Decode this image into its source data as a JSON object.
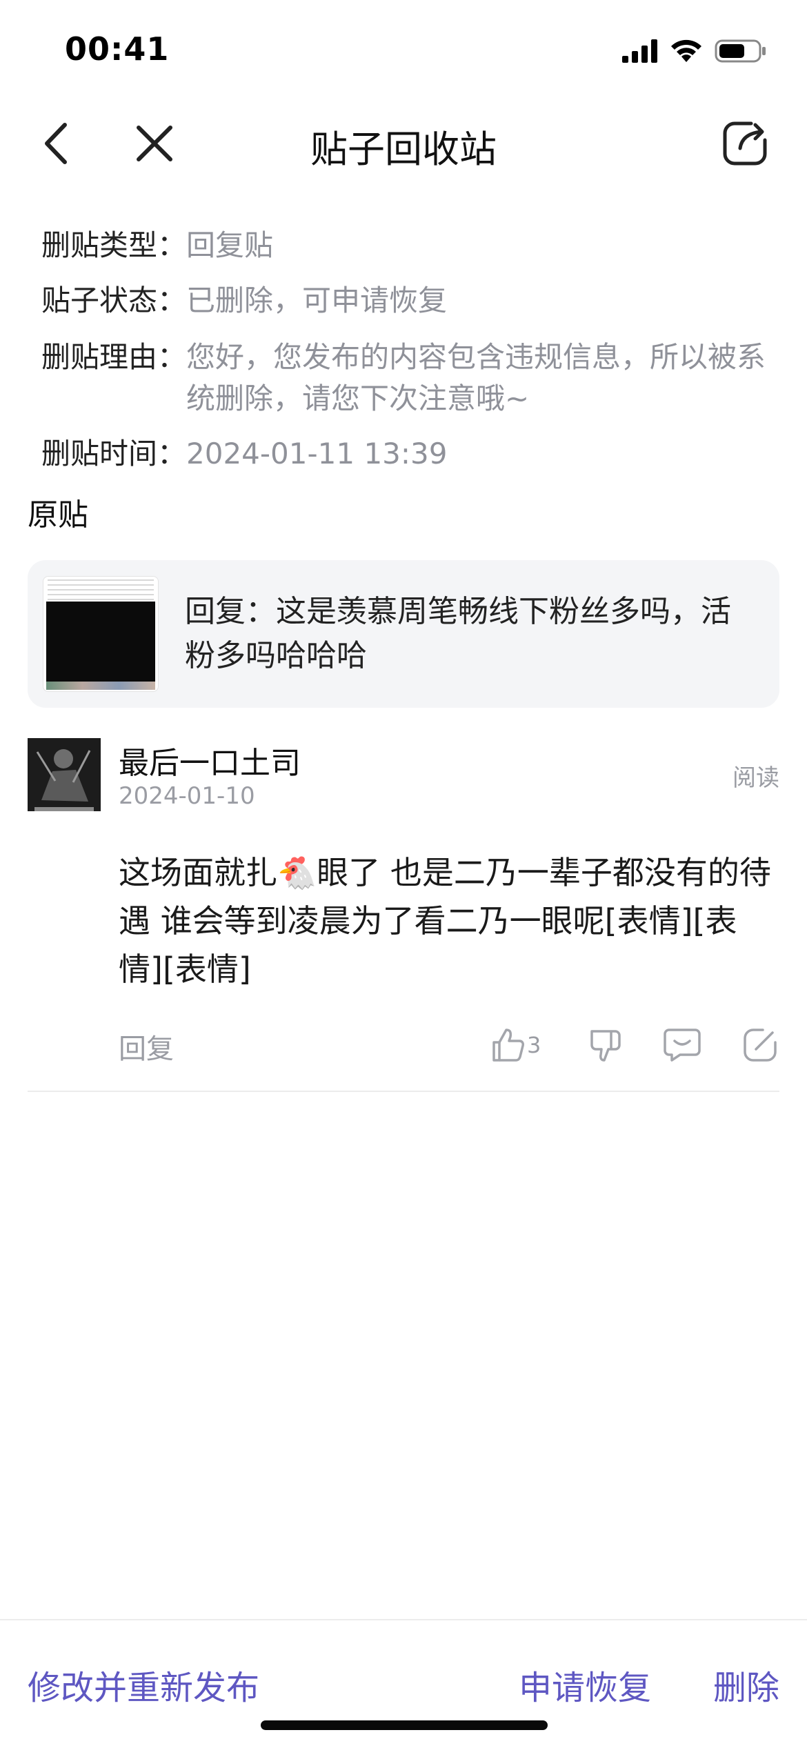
{
  "status_bar": {
    "time": "00:41",
    "icons": [
      "signal-icon",
      "wifi-icon",
      "battery-icon"
    ]
  },
  "nav": {
    "title": "贴子回收站",
    "icons": [
      "back-icon",
      "close-icon",
      "share-icon"
    ]
  },
  "info": {
    "type_label": "删贴类型：",
    "type_value": "回复贴",
    "status_label": "贴子状态：",
    "status_value": "已删除，可申请恢复",
    "reason_label": "删贴理由：",
    "reason_value": "您好，您发布的内容包含违规信息，所以被系统删除，请您下次注意哦~",
    "time_label": "删贴时间：",
    "time_value": "2024-01-11 13:39"
  },
  "original": {
    "section_title": "原贴",
    "text": "回复：这是羡慕周笔畅线下粉丝多吗，活粉多吗哈哈哈"
  },
  "reply": {
    "author": "最后一口土司",
    "date": "2024-01-10",
    "read_tag": "阅读",
    "content": " 这场面就扎🐔眼了 也是二乃一辈子都没有的待遇 谁会等到凌晨为了看二乃一眼呢[表情][表情][表情]",
    "reply_label": "回复",
    "like_count": "3",
    "action_icons": [
      "thumbs-up-icon",
      "thumbs-down-icon",
      "comment-icon",
      "edit-icon"
    ]
  },
  "bottom": {
    "edit_republish": "修改并重新发布",
    "apply_restore": "申请恢复",
    "delete": "删除"
  },
  "colors": {
    "accent": "#5e57c2",
    "muted_text": "#8f9199",
    "card_bg": "#f4f5f7"
  }
}
